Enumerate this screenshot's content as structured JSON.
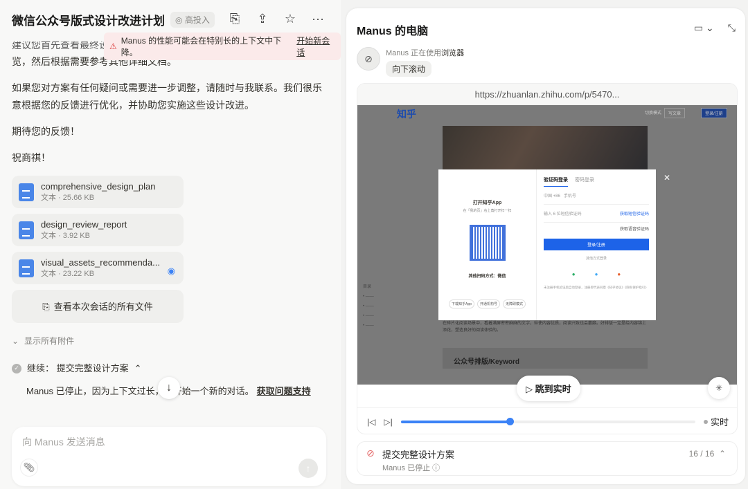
{
  "left": {
    "title": "微信公众号版式设计改进计划",
    "badge": "高投入",
    "warning": "Manus 的性能可能会在特别长的上下文中下降。",
    "warning_link": "开始新会话",
    "messages": [
      "建议您首先查看最终设计方案(final_design_proposal.md)，获取整体概",
      "览，然后根据需要参考其他详细文档。",
      "如果您对方案有任何疑问或需要进一步调整，请随时与我联系。我们很乐意根据您的反馈进行优化，并协助您实施这些设计改进。",
      "期待您的反馈！",
      "祝商祺！"
    ],
    "files": [
      {
        "name": "comprehensive_design_plan",
        "meta": "文本 · 25.66 KB"
      },
      {
        "name": "design_review_report",
        "meta": "文本 · 3.92 KB"
      },
      {
        "name": "visual_assets_recommenda...",
        "meta": "文本 · 23.22 KB"
      }
    ],
    "all_files": "查看本次会话的所有文件",
    "show_all": "显示所有附件",
    "step": "继续：  提交完整设计方案",
    "stopped": "Manus 已停止，因为上下文过长，请开始一个新的对话。",
    "support_link": "获取问题支持",
    "input_placeholder": "向 Manus 发送消息"
  },
  "right": {
    "title": "Manus 的电脑",
    "agent_status": "Manus 正在使用",
    "agent_tool": "浏览器",
    "action": "向下滚动",
    "url": "https://zhuanlan.zhihu.com/p/5470...",
    "page": {
      "logo": "知乎",
      "header_links": [
        "切换模式",
        "写文章",
        "登录/注册"
      ],
      "modal_title": "打开知乎App",
      "modal_sub": "在「我的页」右上角打开扫一扫",
      "other_scan": "其他扫码方式：微信",
      "modal_buttons": [
        "下载知乎App",
        "开通机构号",
        "无障碍模式"
      ],
      "tabs": [
        "验证码登录",
        "密码登录"
      ],
      "country": "中国 +86",
      "phone": "手机号",
      "code": "输入 6 位短信验证码",
      "get_sms": "获取短信验证码",
      "get_voice": "获取语音验证码",
      "login": "登录/注册",
      "other_login": "其他方式登录",
      "terms": "未注册手机验证后自动登录，注册即代表同意《知乎协议》《隐私保护指引》",
      "article": "在碎片化阅读场景中，看着满屏密密麻麻的文字，纵使内容优质，阅读兴致也会萎靡。好排版一定是给内容锦上添花，塑造良好的阅读体验的。",
      "keyword": "公众号排版/Keyword",
      "toc": "目录"
    },
    "jump_live": "跳到实时",
    "live": "实时",
    "progress": 0.37,
    "task": "提交完整设计方案",
    "task_status": "Manus 已停止",
    "task_count": "16 / 16"
  }
}
